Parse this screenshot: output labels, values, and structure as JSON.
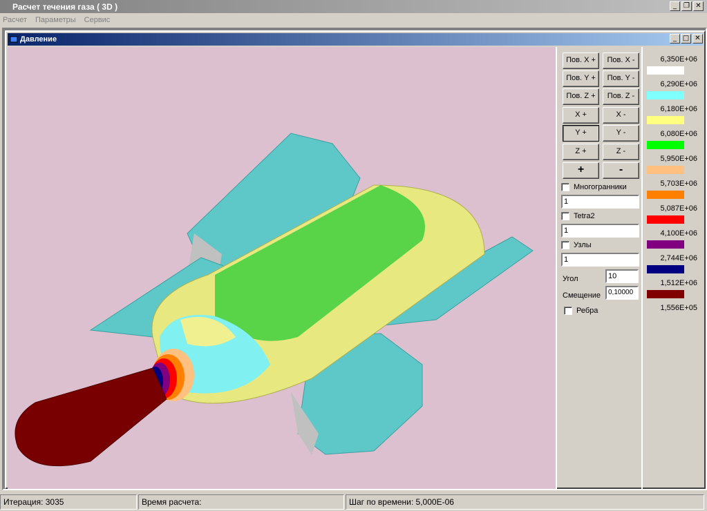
{
  "app": {
    "title": "Расчет течения газа ( 3D )"
  },
  "menu": {
    "items": [
      "Расчет",
      "Параметры",
      "Сервис"
    ]
  },
  "child": {
    "title": "Давление"
  },
  "controls": {
    "buttons": [
      [
        "Пов. X +",
        "Пов. X -"
      ],
      [
        "Пов. Y +",
        "Пов. Y -"
      ],
      [
        "Пов. Z +",
        "Пов. Z -"
      ],
      [
        "X +",
        "X -"
      ],
      [
        "Y +",
        "Y -"
      ],
      [
        "Z +",
        "Z -"
      ],
      [
        "+",
        "-"
      ]
    ],
    "polyhedra_label": "Многогранники",
    "polyhedra_value": "1",
    "tetra_label": "Tetra2",
    "tetra_value": "1",
    "nodes_label": "Узлы",
    "nodes_value": "1",
    "angle_label": "Угол",
    "angle_value": "10",
    "offset_label": "Смещение",
    "offset_value": "0,10000",
    "edges_label": "Ребра"
  },
  "legend": {
    "values": [
      "6,350E+06",
      "6,290E+06",
      "6,180E+06",
      "6,080E+06",
      "5,950E+06",
      "5,703E+06",
      "5,087E+06",
      "4,100E+06",
      "2,744E+06",
      "1,512E+06",
      "1,556E+05"
    ],
    "colors": [
      "#ffffff",
      "#80ffff",
      "#ffff80",
      "#00ff00",
      "#ffc080",
      "#ff8000",
      "#ff0000",
      "#800080",
      "#000080",
      "#800000"
    ]
  },
  "status": {
    "iteration": "Итерация:  3035",
    "calc_time": "Время расчета:",
    "time_step": "Шаг по времени:  5,000E-06"
  }
}
